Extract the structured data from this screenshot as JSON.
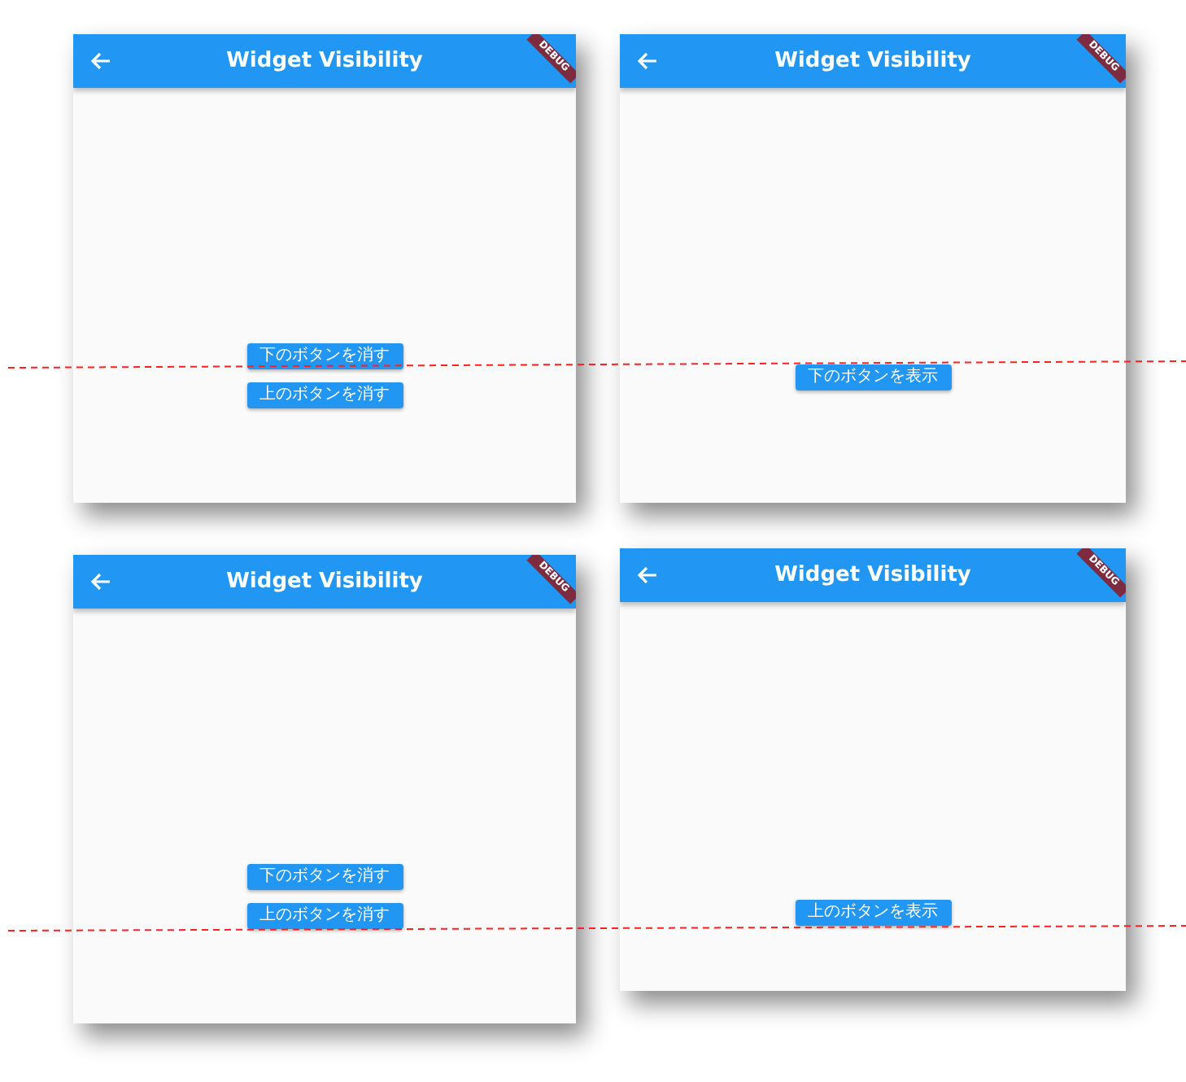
{
  "screens": [
    {
      "title": "Widget Visibility",
      "debug_banner": "DEBUG",
      "buttons": [
        "下のボタンを消す",
        "上のボタンを消す"
      ]
    },
    {
      "title": "Widget Visibility",
      "debug_banner": "DEBUG",
      "buttons": [
        "下のボタンを表示"
      ]
    },
    {
      "title": "Widget Visibility",
      "debug_banner": "DEBUG",
      "buttons": [
        "下のボタンを消す",
        "上のボタンを消す"
      ]
    },
    {
      "title": "Widget Visibility",
      "debug_banner": "DEBUG",
      "buttons": [
        "上のボタンを表示"
      ]
    }
  ]
}
